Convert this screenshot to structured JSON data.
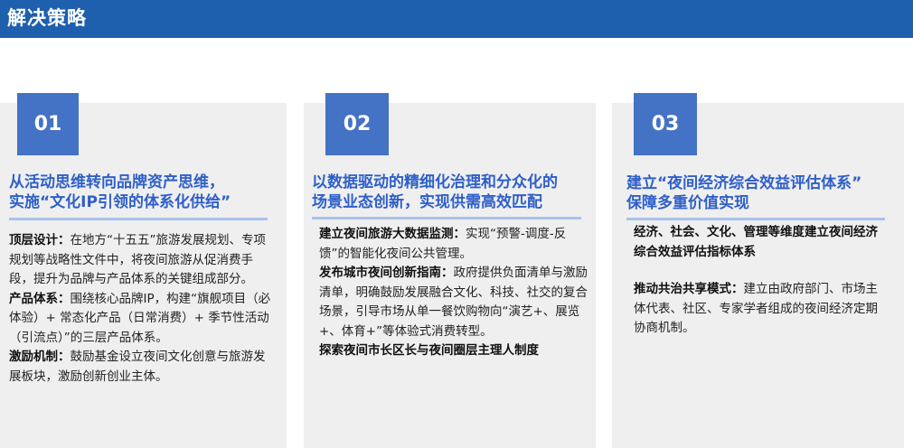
{
  "header": {
    "title": "解决策略"
  },
  "cards": [
    {
      "number": "01",
      "title_lines": [
        "从活动思维转向品牌资产思维，",
        "实施“文化IP引领的体系化供给”"
      ],
      "paragraphs": [
        {
          "lead": "顶层设计：",
          "text": "在地方“十五五”旅游发展规划、专项规划等战略性文件中，将夜间旅游从促消费手段，提升为品牌与产品体系的关键组成部分。"
        },
        {
          "lead": "产品体系：",
          "text": "围绕核心品牌IP，构建“旗舰项目（必体验）+ 常态化产品（日常消费）+ 季节性活动（引流点）”的三层产品体系。"
        },
        {
          "lead": "激励机制：",
          "text": "鼓励基金设立夜间文化创意与旅游发展板块，激励创新创业主体。"
        }
      ]
    },
    {
      "number": "02",
      "title_lines": [
        "以数据驱动的精细化治理和分众化的",
        "场景业态创新，实现供需高效匹配"
      ],
      "paragraphs": [
        {
          "lead": "建立夜间旅游大数据监测：",
          "text": "实现“预警-调度-反馈”的智能化夜间公共管理。"
        },
        {
          "lead": "发布城市夜间创新指南：",
          "text": "政府提供负面清单与激励清单，明确鼓励发展融合文化、科技、社交的复合场景，引导市场从单一餐饮购物向“演艺+、展览+、体育+”等体验式消费转型。"
        },
        {
          "lead": "探索夜间市长区长与夜间圈层主理人制度",
          "text": ""
        }
      ]
    },
    {
      "number": "03",
      "title_lines": [
        "建立“夜间经济综合效益评估体系”",
        "保障多重价值实现"
      ],
      "paragraphs": [
        {
          "lead": "经济、社会、文化、管理等维度建立夜间经济综合效益评估指标体系",
          "text": ""
        },
        {
          "lead": "推动共治共享模式：",
          "text": "建立由政府部门、市场主体代表、社区、专家学者组成的夜间经济定期协商机制。"
        }
      ]
    }
  ],
  "colors": {
    "header_bg": "#1e5fae",
    "number_bg": "#4472c4",
    "title_text": "#2e5fc9",
    "card_bg": "#efefef",
    "rule": "#a9c2e8"
  }
}
